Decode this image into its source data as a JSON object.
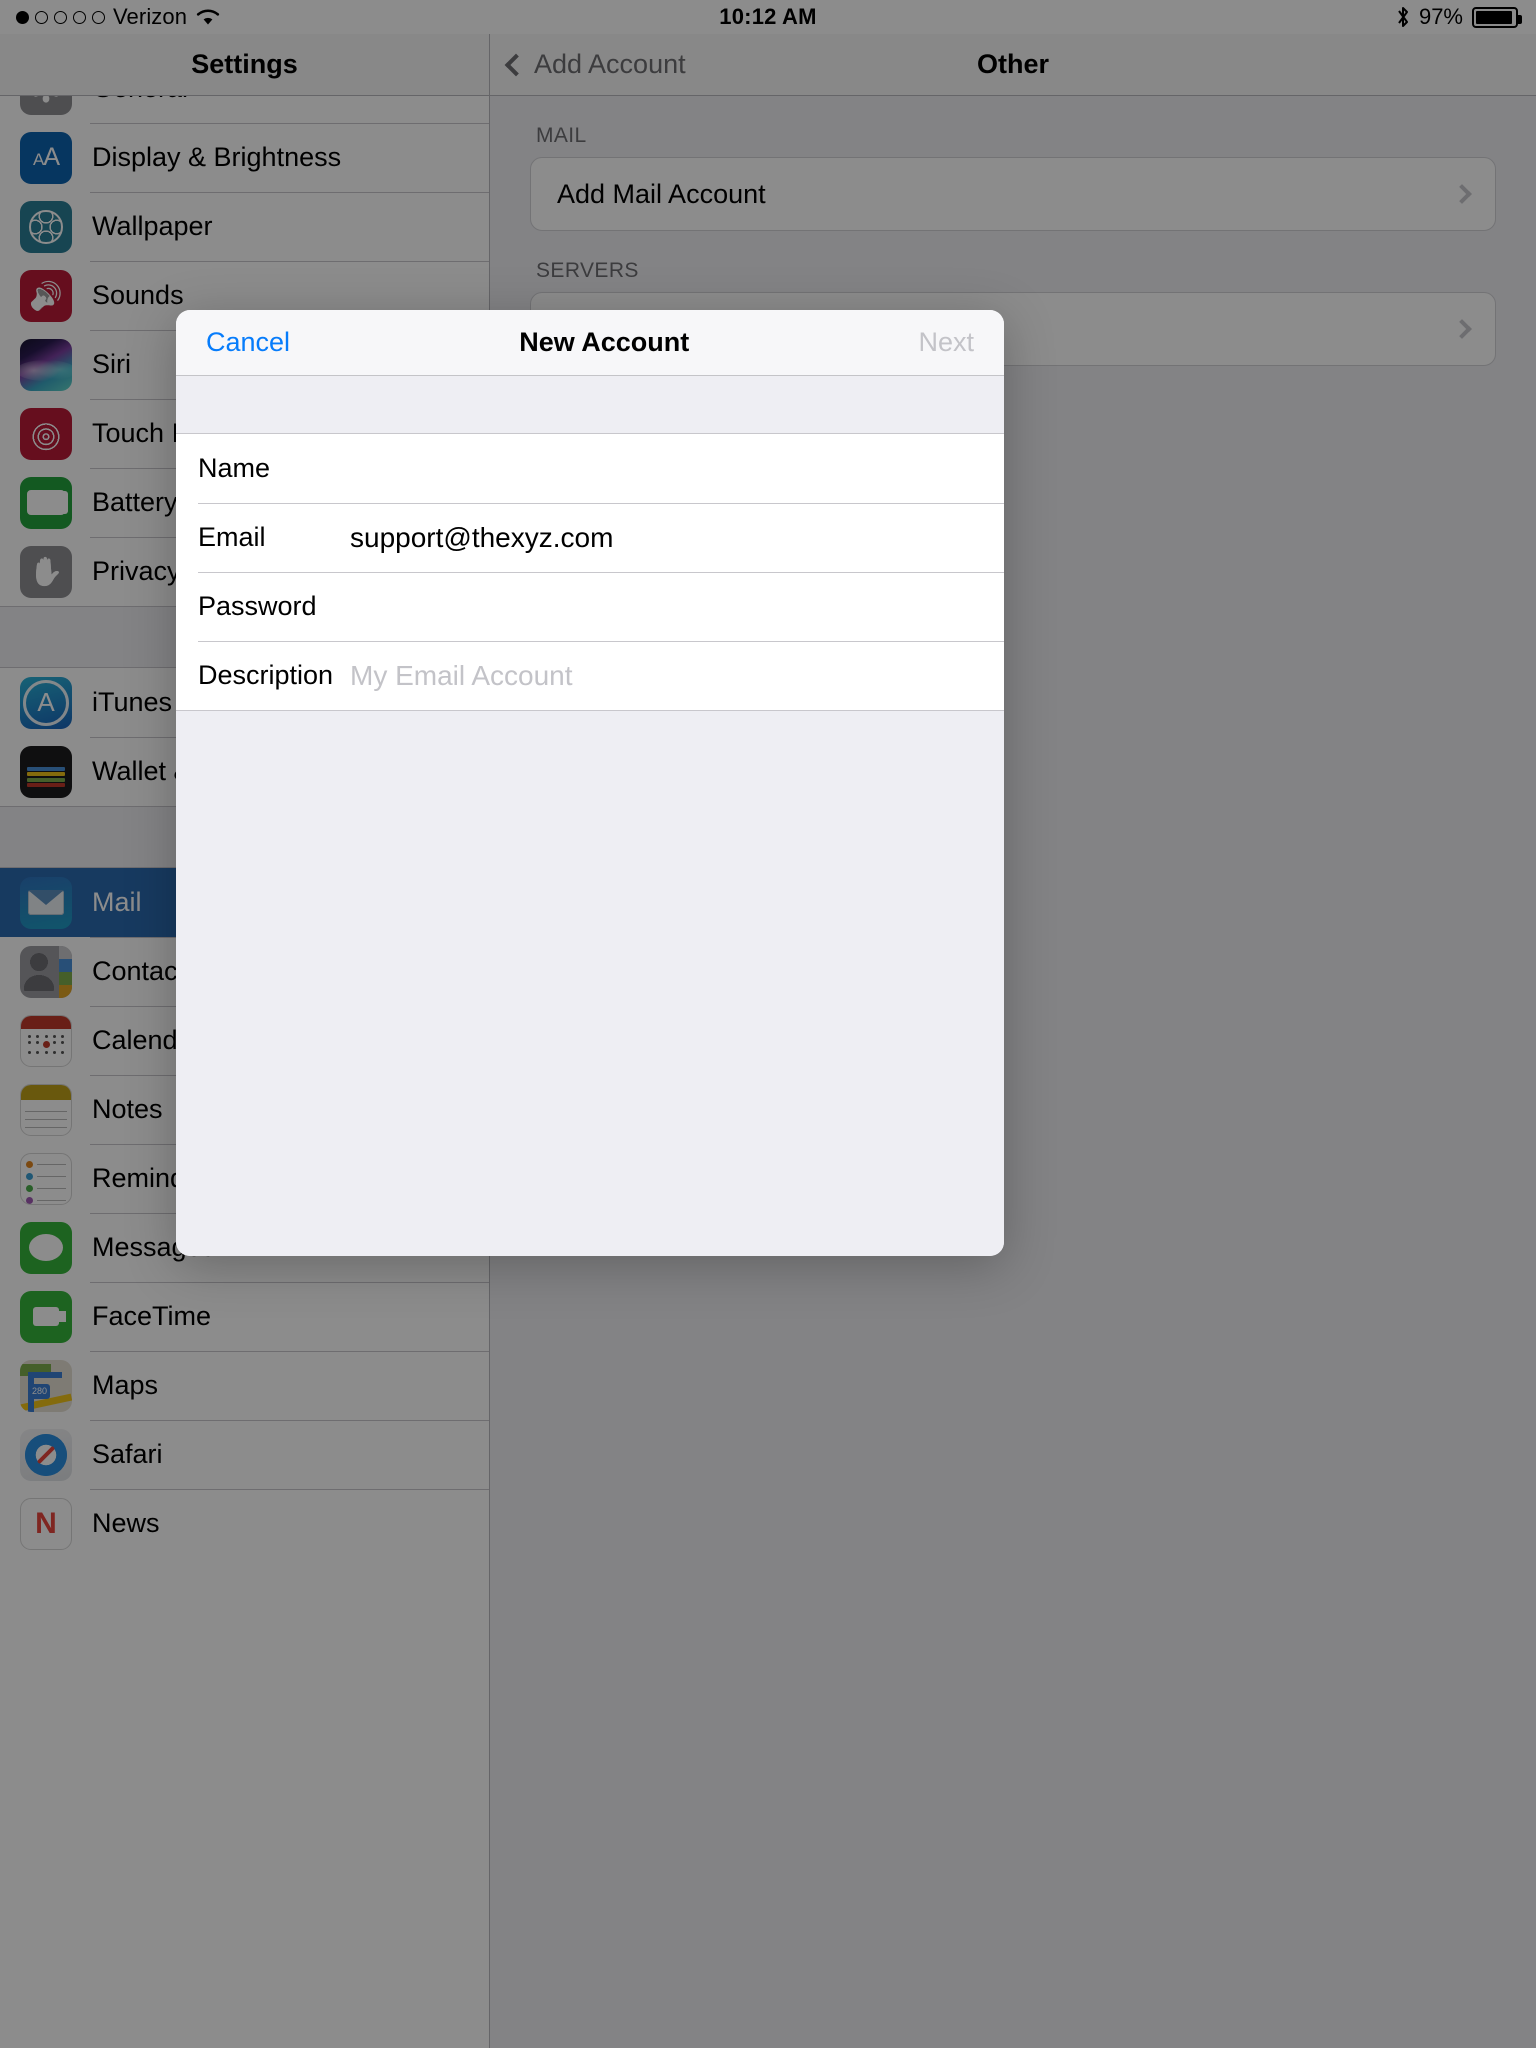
{
  "status_bar": {
    "carrier": "Verizon",
    "signal_dots_total": 5,
    "signal_dots_filled": 1,
    "wifi_icon": "wifi-icon",
    "time": "10:12 AM",
    "bluetooth_icon": "bluetooth-icon",
    "battery_percent": "97%",
    "battery_icon": "battery-icon"
  },
  "left_pane": {
    "nav_title": "Settings",
    "items": [
      {
        "label": "General",
        "icon": "general-gear-icon",
        "selected": false
      },
      {
        "label": "Display & Brightness",
        "icon": "display-brightness-icon",
        "selected": false
      },
      {
        "label": "Wallpaper",
        "icon": "wallpaper-icon",
        "selected": false
      },
      {
        "label": "Sounds",
        "icon": "sounds-speaker-icon",
        "selected": false
      },
      {
        "label": "Siri",
        "icon": "siri-icon",
        "selected": false
      },
      {
        "label": "Touch ID",
        "icon": "touch-id-fingerprint-icon",
        "selected": false
      },
      {
        "label": "Battery",
        "icon": "battery-icon",
        "selected": false
      },
      {
        "label": "Privacy",
        "icon": "privacy-hand-icon",
        "selected": false
      },
      {
        "label": "iTunes",
        "icon": "itunes-app-store-icon",
        "selected": false
      },
      {
        "label": "Wallet &",
        "icon": "wallet-icon",
        "selected": false
      },
      {
        "label": "Mail",
        "icon": "mail-envelope-icon",
        "selected": true
      },
      {
        "label": "Contacts",
        "icon": "contacts-icon",
        "selected": false
      },
      {
        "label": "Calendar",
        "icon": "calendar-icon",
        "selected": false
      },
      {
        "label": "Notes",
        "icon": "notes-icon",
        "selected": false
      },
      {
        "label": "Reminders",
        "icon": "reminders-icon",
        "selected": false
      },
      {
        "label": "Messages",
        "icon": "messages-icon",
        "selected": false
      },
      {
        "label": "FaceTime",
        "icon": "facetime-icon",
        "selected": false
      },
      {
        "label": "Maps",
        "icon": "maps-icon",
        "selected": false
      },
      {
        "label": "Safari",
        "icon": "safari-compass-icon",
        "selected": false
      },
      {
        "label": "News",
        "icon": "news-icon",
        "selected": false
      }
    ]
  },
  "right_pane": {
    "back_label": "Add Account",
    "back_icon": "chevron-left-icon",
    "nav_title": "Other",
    "mail_section_header": "MAIL",
    "add_mail_account_label": "Add Mail Account",
    "disclosure_icon": "chevron-right-icon",
    "servers_section_header": "SERVERS"
  },
  "modal": {
    "cancel_label": "Cancel",
    "title": "New Account",
    "next_label": "Next",
    "fields": [
      {
        "label": "Name",
        "value": "",
        "placeholder": ""
      },
      {
        "label": "Email",
        "value": "support@thexyz.com",
        "placeholder": ""
      },
      {
        "label": "Password",
        "value": "",
        "placeholder": ""
      },
      {
        "label": "Description",
        "value": "",
        "placeholder": "My Email Account"
      }
    ]
  },
  "colors": {
    "ios_blue": "#067cfb",
    "disabled_grey": "#c3c3c8",
    "selected_row": "#2a6bb0",
    "group_bg": "#eeeef3"
  }
}
